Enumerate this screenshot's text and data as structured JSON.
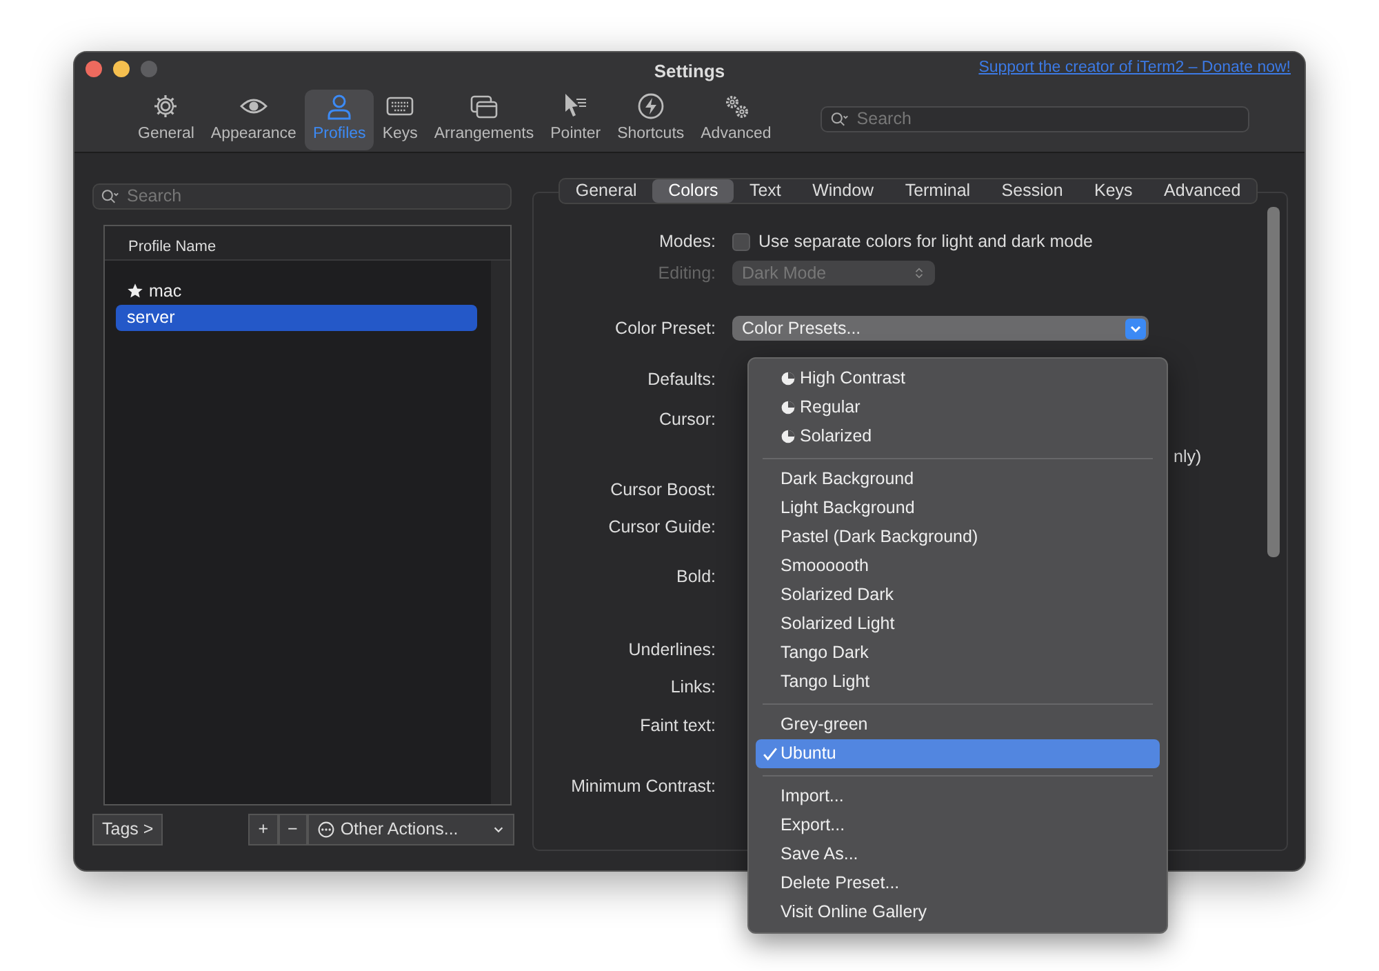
{
  "window": {
    "title": "Settings",
    "donate_link": "Support the creator of iTerm2 – Donate now!"
  },
  "toolbar": {
    "items": [
      {
        "label": "General",
        "selected": false
      },
      {
        "label": "Appearance",
        "selected": false
      },
      {
        "label": "Profiles",
        "selected": true
      },
      {
        "label": "Keys",
        "selected": false
      },
      {
        "label": "Arrangements",
        "selected": false
      },
      {
        "label": "Pointer",
        "selected": false
      },
      {
        "label": "Shortcuts",
        "selected": false
      },
      {
        "label": "Advanced",
        "selected": false
      }
    ],
    "search": {
      "placeholder": "Search"
    }
  },
  "sidebar": {
    "search": {
      "placeholder": "Search"
    },
    "column": "Profile Name",
    "profiles": [
      {
        "name": "mac",
        "default": true,
        "selected": false
      },
      {
        "name": "server",
        "default": false,
        "selected": true
      }
    ],
    "tags_button": "Tags >",
    "add_button": "+",
    "remove_button": "−",
    "other_actions": "Other Actions..."
  },
  "profile_tabs": [
    {
      "label": "General",
      "selected": false
    },
    {
      "label": "Colors",
      "selected": true
    },
    {
      "label": "Text",
      "selected": false
    },
    {
      "label": "Window",
      "selected": false
    },
    {
      "label": "Terminal",
      "selected": false
    },
    {
      "label": "Session",
      "selected": false
    },
    {
      "label": "Keys",
      "selected": false
    },
    {
      "label": "Advanced",
      "selected": false
    }
  ],
  "form": {
    "rows": [
      {
        "kind": "checkbox",
        "label": "Modes:",
        "text": "Use separate colors for light and dark mode",
        "checked": false
      },
      {
        "kind": "select",
        "label": "Editing:",
        "value": "Dark Mode",
        "disabled": true
      },
      {
        "kind": "preset",
        "label": "Color Preset:",
        "value": "Color Presets...",
        "open": true
      },
      {
        "kind": "label",
        "label": "Defaults:"
      },
      {
        "kind": "label",
        "label": "Cursor:"
      },
      {
        "kind": "overflow",
        "text": "nly)"
      },
      {
        "kind": "label",
        "label": "Cursor Boost:"
      },
      {
        "kind": "label",
        "label": "Cursor Guide:"
      },
      {
        "kind": "label",
        "label": "Bold:"
      },
      {
        "kind": "label",
        "label": "Underlines:"
      },
      {
        "kind": "label",
        "label": "Links:"
      },
      {
        "kind": "label",
        "label": "Faint text:"
      },
      {
        "kind": "label",
        "label": "Minimum Contrast:"
      }
    ]
  },
  "preset_menu": {
    "sections": [
      [
        {
          "label": "High Contrast",
          "adaptive": true,
          "checked": false
        },
        {
          "label": "Regular",
          "adaptive": true,
          "checked": false
        },
        {
          "label": "Solarized",
          "adaptive": true,
          "checked": false
        }
      ],
      [
        {
          "label": "Dark Background",
          "adaptive": false,
          "checked": false
        },
        {
          "label": "Light Background",
          "adaptive": false,
          "checked": false
        },
        {
          "label": "Pastel (Dark Background)",
          "adaptive": false,
          "checked": false
        },
        {
          "label": "Smoooooth",
          "adaptive": false,
          "checked": false
        },
        {
          "label": "Solarized Dark",
          "adaptive": false,
          "checked": false
        },
        {
          "label": "Solarized Light",
          "adaptive": false,
          "checked": false
        },
        {
          "label": "Tango Dark",
          "adaptive": false,
          "checked": false
        },
        {
          "label": "Tango Light",
          "adaptive": false,
          "checked": false
        }
      ],
      [
        {
          "label": "Grey-green",
          "adaptive": false,
          "checked": false
        },
        {
          "label": "Ubuntu",
          "adaptive": false,
          "checked": true
        }
      ],
      [
        {
          "label": "Import...",
          "adaptive": false,
          "checked": false
        },
        {
          "label": "Export...",
          "adaptive": false,
          "checked": false
        },
        {
          "label": "Save As...",
          "adaptive": false,
          "checked": false
        },
        {
          "label": "Delete Preset...",
          "adaptive": false,
          "checked": false
        },
        {
          "label": "Visit Online Gallery",
          "adaptive": false,
          "checked": false
        }
      ]
    ]
  }
}
